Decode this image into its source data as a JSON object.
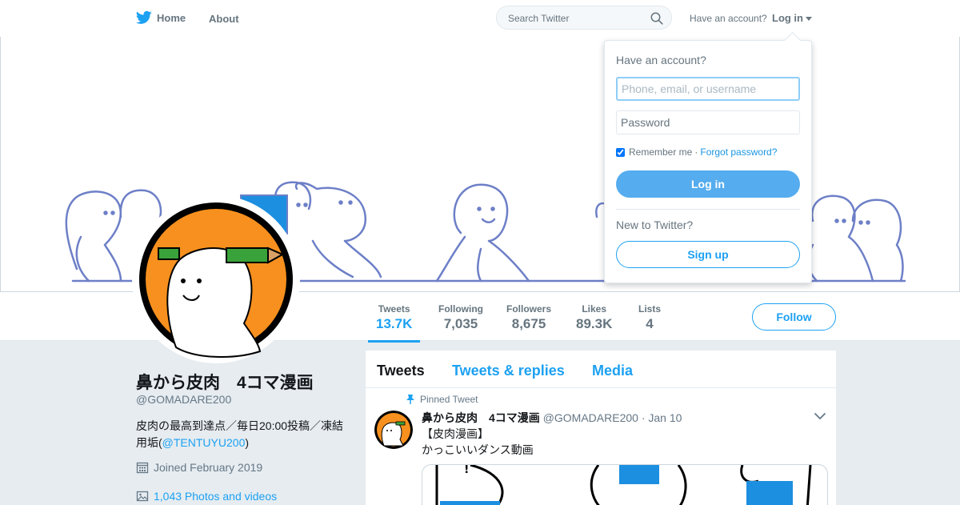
{
  "nav": {
    "home_label": "Home",
    "about_label": "About",
    "search_placeholder": "Search Twitter",
    "have_account": "Have an account?",
    "login_label": "Log in"
  },
  "stats": [
    {
      "label": "Tweets",
      "value": "13.7K"
    },
    {
      "label": "Following",
      "value": "7,035"
    },
    {
      "label": "Followers",
      "value": "8,675"
    },
    {
      "label": "Likes",
      "value": "89.3K"
    },
    {
      "label": "Lists",
      "value": "4"
    }
  ],
  "follow_label": "Follow",
  "profile": {
    "name": "鼻から皮肉　4コマ漫画",
    "handle": "@GOMADARE200",
    "bio_text": "皮肉の最高到達点／毎日20:00投稿／凍結用垢(",
    "bio_link": "@TENTUYU200",
    "bio_end": ")",
    "joined": "Joined February 2019",
    "photos": "1,043 Photos and videos"
  },
  "timeline": {
    "tabs": [
      "Tweets",
      "Tweets & replies",
      "Media"
    ],
    "pinned_label": "Pinned Tweet",
    "tweet": {
      "name": "鼻から皮肉　4コマ漫画",
      "handle": "@GOMADARE200",
      "date": "· Jan 10",
      "line1": "【皮肉漫画】",
      "line2": "かっこいいダンス動画"
    }
  },
  "login_dropdown": {
    "title": "Have an account?",
    "username_placeholder": "Phone, email, or username",
    "password_placeholder": "Password",
    "remember_label": "Remember me",
    "separator": "·",
    "forgot_label": "Forgot password?",
    "login_button": "Log in",
    "new_label": "New to Twitter?",
    "signup_button": "Sign up"
  },
  "colors": {
    "accent": "#1da1f2",
    "login_button": "#55acee",
    "avatar_orange": "#f7901e",
    "banner_figure_stroke": "#6d7fc7"
  }
}
